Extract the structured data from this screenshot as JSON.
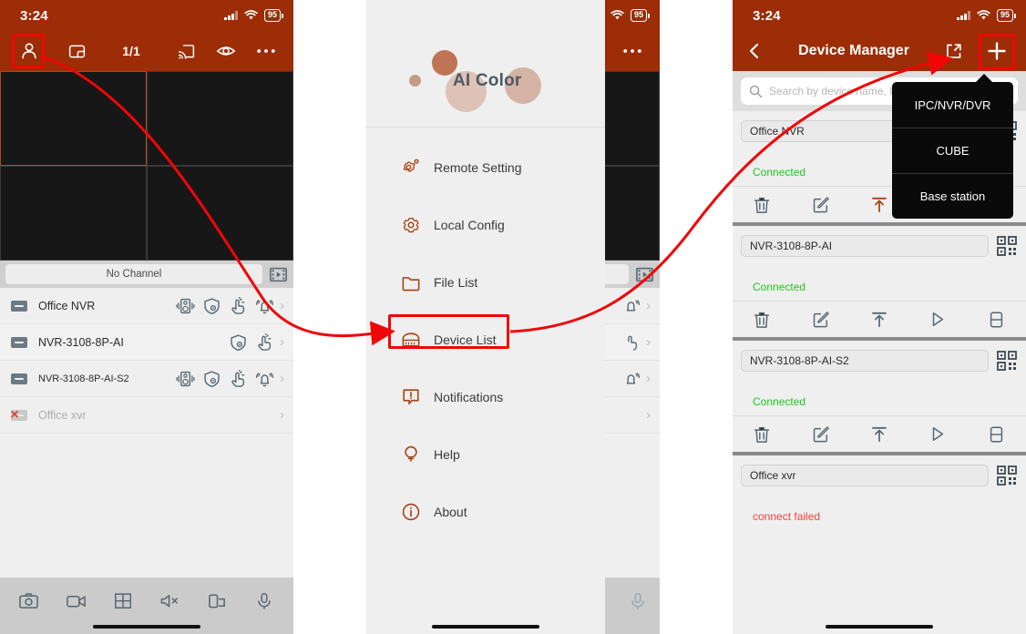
{
  "status_bar": {
    "time": "3:24",
    "battery": "95",
    "wifi_icon": "wifi-icon",
    "signal_icon": "signal-icon"
  },
  "panel1": {
    "nav": {
      "profile_icon": "person-icon",
      "layout_icon": "picture-in-picture-icon",
      "page_indicator": "1/1",
      "cast_icon": "cast-icon",
      "eye_icon": "eye-icon",
      "more_icon": "more-horizontal-icon"
    },
    "channel_bar": {
      "label": "No Channel",
      "playback_icon": "film-strip-play-icon"
    },
    "devices": [
      {
        "name": "Office NVR",
        "online": true,
        "icons": [
          "intercom-icon",
          "shield-gear-icon",
          "hand-touch-icon",
          "bell-alarm-icon"
        ]
      },
      {
        "name": "NVR-3108-8P-AI",
        "online": true,
        "icons": [
          "shield-gear-icon",
          "hand-touch-icon"
        ]
      },
      {
        "name": "NVR-3108-8P-AI-S2",
        "online": true,
        "icons": [
          "intercom-icon",
          "shield-gear-icon",
          "hand-touch-icon",
          "bell-alarm-icon"
        ]
      },
      {
        "name": "Office xvr",
        "online": false,
        "icons": []
      }
    ],
    "toolbar": [
      "camera-snapshot-icon",
      "video-record-icon",
      "grid-layout-icon",
      "speaker-mute-icon",
      "stream-switch-icon",
      "microphone-icon"
    ]
  },
  "panel2": {
    "drawer": {
      "brand": "AI Color",
      "menu": [
        {
          "label": "Remote Setting",
          "icon": "gear-remote-icon"
        },
        {
          "label": "Local Config",
          "icon": "gear-icon"
        },
        {
          "label": "File List",
          "icon": "folder-icon"
        },
        {
          "label": "Device List",
          "icon": "server-device-icon",
          "highlighted": true
        },
        {
          "label": "Notifications",
          "icon": "notification-alert-icon"
        },
        {
          "label": "Help",
          "icon": "lightbulb-icon"
        },
        {
          "label": "About",
          "icon": "info-circle-icon"
        }
      ]
    }
  },
  "panel3": {
    "nav": {
      "back_icon": "chevron-left-icon",
      "title": "Device Manager",
      "share_icon": "external-link-icon",
      "add_icon": "plus-icon"
    },
    "search": {
      "placeholder": "Search by device name, IP",
      "icon": "search-icon"
    },
    "popup_menu": {
      "items": [
        {
          "label": "IPC/NVR/DVR",
          "highlighted": true
        },
        {
          "label": "CUBE",
          "highlighted": false
        },
        {
          "label": "Base station",
          "highlighted": false
        }
      ]
    },
    "device_cards": [
      {
        "name": "Office NVR",
        "status": "Connected",
        "status_state": "ok"
      },
      {
        "name": "NVR-3108-8P-AI",
        "status": "Connected",
        "status_state": "ok"
      },
      {
        "name": "NVR-3108-8P-AI-S2",
        "status": "Connected",
        "status_state": "ok"
      },
      {
        "name": "Office xvr",
        "status": "connect failed",
        "status_state": "fail"
      }
    ],
    "card_actions": [
      "delete-icon",
      "edit-icon",
      "upgrade-icon",
      "play-icon",
      "storage-icon"
    ],
    "qr_icon": "qr-code-icon"
  },
  "colors": {
    "header": "#9c2d06",
    "annotation": "#f00606",
    "connected": "#22c522",
    "failed": "#f4443c",
    "accent_icon": "#a8400f"
  }
}
